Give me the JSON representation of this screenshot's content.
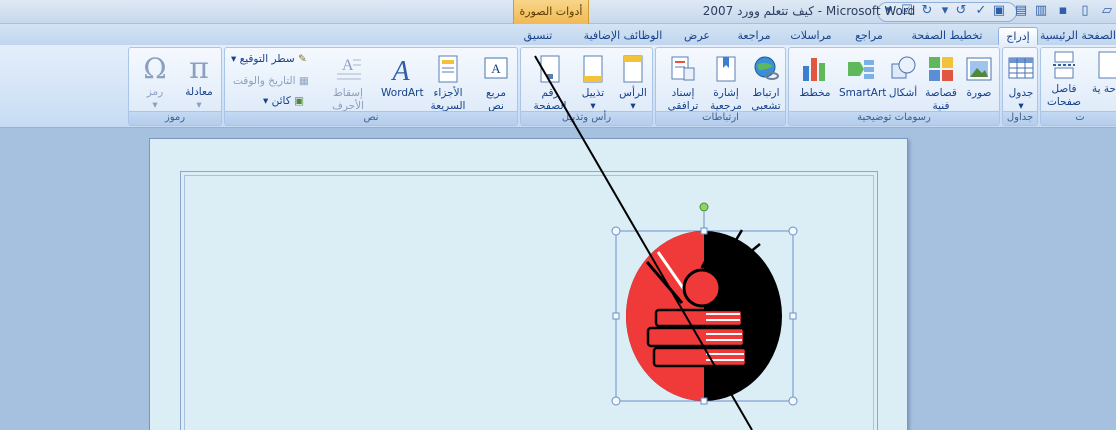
{
  "window": {
    "title": "كيف تتعلم وورد 2007 - Microsoft Word",
    "context_tab_group": "أدوات الصورة"
  },
  "tabs": [
    {
      "label": "الصفحة الرئيسية"
    },
    {
      "label": "إدراج"
    },
    {
      "label": "تخطيط الصفحة"
    },
    {
      "label": "مراجع"
    },
    {
      "label": "مراسلات"
    },
    {
      "label": "مراجعة"
    },
    {
      "label": "عرض"
    },
    {
      "label": "الوظائف الإضافية"
    },
    {
      "label": "تنسيق"
    }
  ],
  "groups": {
    "pages": {
      "label": "ت",
      "items": [
        "فاصل صفحات",
        "حة ية"
      ]
    },
    "tables": {
      "label": "جداول",
      "items": [
        "جدول"
      ]
    },
    "illustrations": {
      "label": "رسومات توضيحية",
      "items": [
        "صورة",
        "قصاصة فنية",
        "أشكال",
        "SmartArt",
        "مخطط"
      ]
    },
    "links": {
      "label": "ارتباطات",
      "items": [
        "ارتباط تشعبي",
        "إشارة مرجعية",
        "إسناد ترافقي"
      ]
    },
    "header_footer": {
      "label": "رأس وتذييل",
      "items": [
        "الرأس",
        "تذييل",
        "رقم الصفحة"
      ]
    },
    "text": {
      "label": "نص",
      "items": [
        "مربع نص",
        "الأجزاء السريعة",
        "WordArt",
        "إسقاط الأحرف الاستهلالية",
        "سطر التوقيع",
        "التاريخ والوقت",
        "كائن"
      ]
    },
    "symbols": {
      "label": "رموز",
      "items": [
        "معادلة",
        "رمز"
      ]
    }
  },
  "colors": {
    "accent": "#15428b",
    "ribbon": "#dbe8f8",
    "context": "#f0b954",
    "page": "#dbedf5",
    "clipart_red": "#f03a3a"
  },
  "icons": {
    "equation": "π",
    "symbol": "Ω",
    "wordart": "A",
    "textbox": "A"
  }
}
